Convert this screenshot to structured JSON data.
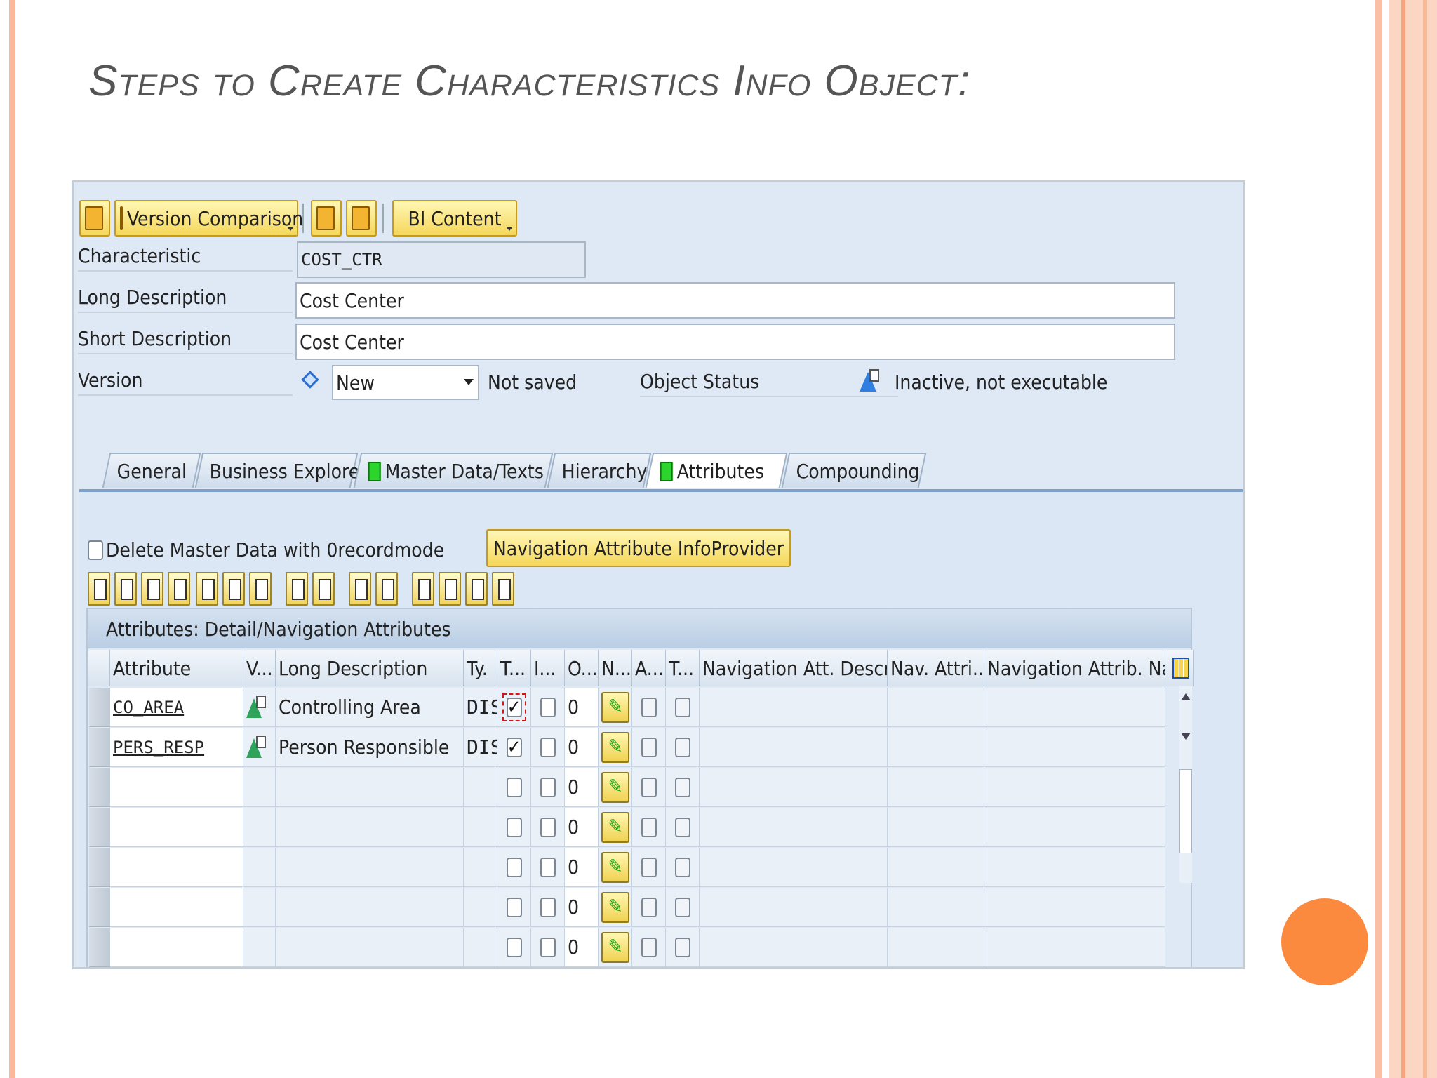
{
  "slide_title": "Steps to Create Characteristics Info Object:",
  "toolbar": {
    "version_comparison_label": "Version Comparison",
    "bi_content_label": "BI Content"
  },
  "form": {
    "characteristic_label": "Characteristic",
    "characteristic_value": "COST_CTR",
    "long_description_label": "Long Description",
    "long_description_value": "Cost Center",
    "short_description_label": "Short Description",
    "short_description_value": "Cost Center",
    "version_label": "Version",
    "version_value": "New",
    "version_status": "Not saved",
    "object_status_label": "Object Status",
    "object_status_value": "Inactive, not executable"
  },
  "tabs": [
    {
      "label": "General"
    },
    {
      "label": "Business Explorer"
    },
    {
      "label": "Master Data/Texts"
    },
    {
      "label": "Hierarchy"
    },
    {
      "label": "Attributes"
    },
    {
      "label": "Compounding"
    }
  ],
  "attributes_tab": {
    "delete_master_data_label": "Delete Master Data with 0recordmode",
    "nav_attr_infoprovider_label": "Navigation Attribute InfoProvider",
    "grid_title": "Attributes: Detail/Navigation Attributes",
    "columns": [
      "Attribute",
      "V...",
      "Long Description",
      "Ty.",
      "T...",
      "I...",
      "O...",
      "N...",
      "A...",
      "T...",
      "Navigation Att. Descrip...",
      "Nav. Attri...",
      "Navigation Attrib. Name"
    ],
    "rows": [
      {
        "attribute": "CO_AREA",
        "long_description": "Controlling Area",
        "type": "DIS",
        "t_checked": true,
        "o_value": "0"
      },
      {
        "attribute": "PERS_RESP",
        "long_description": "Person Responsible",
        "type": "DIS",
        "t_checked": true,
        "o_value": "0"
      },
      {
        "attribute": "",
        "long_description": "",
        "type": "",
        "t_checked": false,
        "o_value": "0"
      },
      {
        "attribute": "",
        "long_description": "",
        "type": "",
        "t_checked": false,
        "o_value": "0"
      },
      {
        "attribute": "",
        "long_description": "",
        "type": "",
        "t_checked": false,
        "o_value": "0"
      },
      {
        "attribute": "",
        "long_description": "",
        "type": "",
        "t_checked": false,
        "o_value": "0"
      },
      {
        "attribute": "",
        "long_description": "",
        "type": "",
        "t_checked": false,
        "o_value": "0"
      }
    ]
  },
  "colors": {
    "accent_orange": "#fb8a3f",
    "sap_background": "#dfe9f5",
    "button_yellow": "#f5d75a",
    "status_green": "#2bd52b"
  }
}
